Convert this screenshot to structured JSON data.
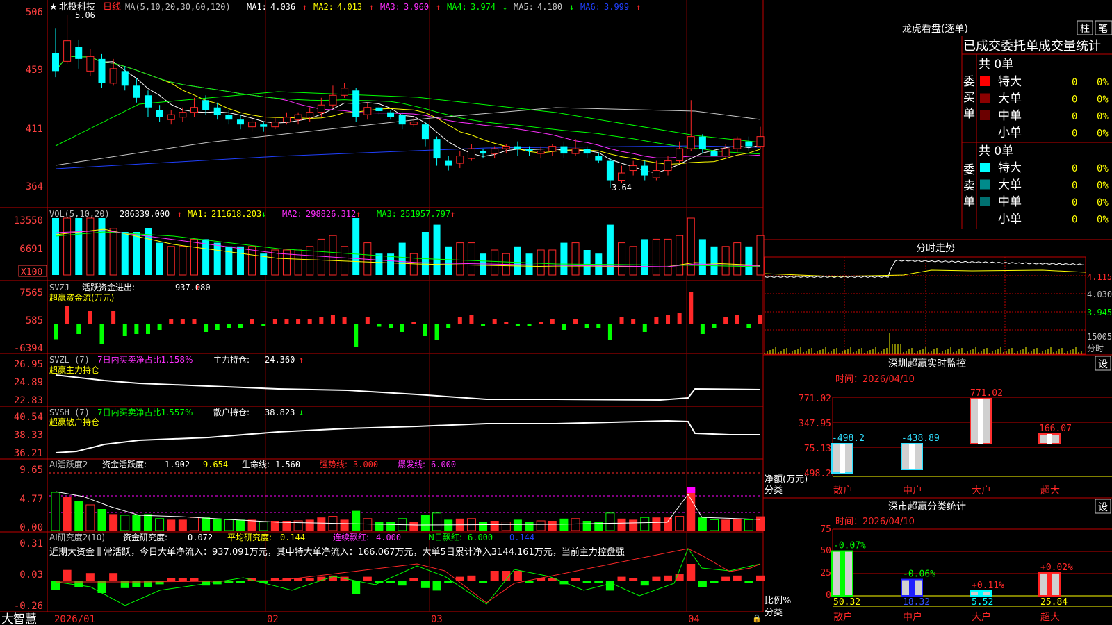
{
  "colors": {
    "up": "#ff2828",
    "down": "#00ffff",
    "frame": "#c00000",
    "grid": "#7a0000",
    "ma1": "#ffffff",
    "ma2": "#ffff00",
    "ma3": "#ff30ff",
    "ma4": "#00ff00",
    "ma5": "#c8c8c8",
    "ma6": "#2040ff",
    "green": "#00ff00",
    "magenta": "#ff00ff",
    "yellow": "#ffff00",
    "axis_text": "#ff4040"
  },
  "header": {
    "star": "★",
    "stock_name": "北投科技",
    "period": "日线",
    "ma_param": "MA(5,10,20,30,60,120)",
    "ma_values": [
      {
        "label": "MA1:",
        "value": "4.036",
        "arrow": "↑"
      },
      {
        "label": "MA2:",
        "value": "4.013",
        "arrow": "↑"
      },
      {
        "label": "MA3:",
        "value": "3.960",
        "arrow": "↑"
      },
      {
        "label": "MA4:",
        "value": "3.974",
        "arrow": "↓"
      },
      {
        "label": "MA5:",
        "value": "4.180",
        "arrow": "↓"
      },
      {
        "label": "MA6:",
        "value": "3.999",
        "arrow": "↑"
      }
    ]
  },
  "price_panel": {
    "y_ticks": [
      "506",
      "459",
      "411",
      "364"
    ],
    "high_label": "5.06",
    "low_label": "3.64"
  },
  "vol_panel": {
    "title": "VOL(5,10,20)",
    "value": "286339.000",
    "value_arrow": "↑",
    "ma_values": [
      {
        "label": "MA1:",
        "value": "211618.203",
        "arrow": "↓"
      },
      {
        "label": "MA2:",
        "value": "298826.312",
        "arrow": "↑"
      },
      {
        "label": "MA3:",
        "value": "251957.797",
        "arrow": "↑"
      }
    ],
    "y_ticks": [
      "13550",
      "6691"
    ],
    "unit": "X100"
  },
  "svzj_panel": {
    "title": "SVZJ",
    "desc": "活跃资金进出:",
    "value": "937.080",
    "arrow": "↑",
    "subtitle": "超赢资金流(万元)",
    "y_ticks": [
      "7565",
      "585",
      "-6394"
    ]
  },
  "svzl_panel": {
    "title": "SVZL (7)",
    "desc": "7日内买卖净占比1.158%",
    "hold_label": "主力持仓:",
    "hold_value": "24.360",
    "arrow": "↑",
    "subtitle": "超赢主力持仓",
    "y_ticks": [
      "26.95",
      "24.89",
      "22.83"
    ]
  },
  "svsh_panel": {
    "title": "SVSH (7)",
    "desc": "7日内买卖净占比1.557%",
    "hold_label": "散户持仓:",
    "hold_value": "38.823",
    "arrow": "↓",
    "subtitle": "超赢散户持仓",
    "y_ticks": [
      "40.54",
      "38.33",
      "36.21"
    ]
  },
  "ai_active_panel": {
    "title": "AI活跃度2",
    "label1": "资金活跃度:",
    "value1": "1.902",
    "value2": "9.654",
    "label3": "生命线:",
    "value3": "1.560",
    "label4": "强势线:",
    "value4": "3.000",
    "label5": "爆发线:",
    "value5": "6.000",
    "y_ticks": [
      "9.65",
      "4.77",
      "0.00"
    ]
  },
  "ai_research_panel": {
    "title": "AI研究度2(10)",
    "label1": "资金研究度:",
    "value1": "0.072",
    "label2": "平均研究度:",
    "value2": "0.144",
    "label3": "连续飘红:",
    "value3": "4.000",
    "label4": "N日飘红:",
    "value4": "6.000",
    "value5": "0.144",
    "comment": "近期大资金非常活跃，今日大单净流入：937.091万元，其中特大单净流入：166.067万元，大单5日累计净入3144.161万元，当前主力控盘强",
    "y_ticks": [
      "0.31",
      "0.03",
      "-0.26"
    ]
  },
  "footer": {
    "brand": "大智慧",
    "dates": [
      "2026/01",
      "02",
      "03",
      "04"
    ]
  },
  "right_panel": {
    "lhb_title": "龙虎看盘(逐单)",
    "btn_zhu": "柱",
    "btn_bi": "笔",
    "stat_title": "已成交委托单成交量统计",
    "buy_group": {
      "side_label": "委买单",
      "total": "共 0单",
      "rows": [
        {
          "name": "特大",
          "count": "0",
          "pct": "0%",
          "color": "#ff0000"
        },
        {
          "name": "大单",
          "count": "0",
          "pct": "0%",
          "color": "#8b0000"
        },
        {
          "name": "中单",
          "count": "0",
          "pct": "0%",
          "color": "#6b0000"
        },
        {
          "name": "小单",
          "count": "0",
          "pct": "0%",
          "color": ""
        }
      ]
    },
    "sell_group": {
      "side_label": "委卖单",
      "total": "共 0单",
      "rows": [
        {
          "name": "特大",
          "count": "0",
          "pct": "0%",
          "color": "#00ffff"
        },
        {
          "name": "大单",
          "count": "0",
          "pct": "0%",
          "color": "#008b8b"
        },
        {
          "name": "中单",
          "count": "0",
          "pct": "0%",
          "color": "#007070"
        },
        {
          "name": "小单",
          "count": "0",
          "pct": "0%",
          "color": ""
        }
      ]
    },
    "intraday": {
      "title": "分时走势",
      "y_ticks": [
        "4.115",
        "4.030",
        "3.945"
      ],
      "vol_tick": "15005",
      "vol_unit": "分时"
    },
    "monitor": {
      "title": "深圳超赢实时监控",
      "settings": "设",
      "time_label": "时间：2026/04/10",
      "y_ticks": [
        "771.02",
        "347.95",
        "-75.13",
        "-498.2"
      ],
      "net_label": "净额(万元)",
      "cat_label": "分类",
      "categories": [
        "散户",
        "中户",
        "大户",
        "超大"
      ],
      "values": [
        -498.2,
        -438.89,
        771.02,
        166.07
      ],
      "value_labels": [
        "-498.2",
        "-438.89",
        "771.02",
        "166.07"
      ]
    },
    "classify": {
      "title": "深市超赢分类统计",
      "settings": "设",
      "time_label": "时间：2026/04/10",
      "y_ticks": [
        "75",
        "50",
        "25",
        "0"
      ],
      "ratio_label": "比例%",
      "cat_label": "分类",
      "categories": [
        "散户",
        "中户",
        "大户",
        "超大"
      ],
      "values": [
        50.32,
        18.32,
        5.52,
        25.84
      ],
      "value_labels": [
        "50.32",
        "18.32",
        "5.52",
        "25.84"
      ],
      "change_labels": [
        "-0.07%",
        "-0.06%",
        "+0.11%",
        "+0.02%"
      ],
      "bar_colors": [
        "#00ff00",
        "#2020ff",
        "#00ffff",
        "#ff2020"
      ]
    }
  },
  "chart_data": {
    "type": "candlestick",
    "dates": [
      "2026/01",
      "02",
      "03",
      "04"
    ],
    "candles": [
      [
        4.75,
        4.6,
        4.95,
        4.55
      ],
      [
        4.68,
        4.85,
        5.06,
        4.66
      ],
      [
        4.8,
        4.7,
        4.86,
        4.62
      ],
      [
        4.6,
        4.72,
        4.78,
        4.56
      ],
      [
        4.7,
        4.5,
        4.74,
        4.46
      ],
      [
        4.5,
        4.62,
        4.7,
        4.48
      ],
      [
        4.6,
        4.48,
        4.64,
        4.44
      ],
      [
        4.48,
        4.38,
        4.54,
        4.34
      ],
      [
        4.4,
        4.3,
        4.44,
        4.22
      ],
      [
        4.28,
        4.22,
        4.32,
        4.18
      ],
      [
        4.2,
        4.24,
        4.28,
        4.16
      ],
      [
        4.22,
        4.26,
        4.3,
        4.18
      ],
      [
        4.26,
        4.3,
        4.38,
        4.22
      ],
      [
        4.36,
        4.28,
        4.4,
        4.24
      ],
      [
        4.3,
        4.24,
        4.34,
        4.2
      ],
      [
        4.24,
        4.2,
        4.28,
        4.16
      ],
      [
        4.2,
        4.16,
        4.24,
        4.12
      ],
      [
        4.14,
        4.18,
        4.22,
        4.1
      ],
      [
        4.16,
        4.14,
        4.18,
        4.1
      ],
      [
        4.14,
        4.18,
        4.22,
        4.12
      ],
      [
        4.18,
        4.22,
        4.26,
        4.16
      ],
      [
        4.2,
        4.24,
        4.26,
        4.16
      ],
      [
        4.22,
        4.26,
        4.3,
        4.18
      ],
      [
        4.26,
        4.32,
        4.38,
        4.22
      ],
      [
        4.32,
        4.4,
        4.48,
        4.3
      ],
      [
        4.4,
        4.46,
        4.5,
        4.38
      ],
      [
        4.44,
        4.22,
        4.46,
        4.18
      ],
      [
        4.24,
        4.3,
        4.34,
        4.2
      ],
      [
        4.3,
        4.27,
        4.32,
        4.24
      ],
      [
        4.26,
        4.22,
        4.28,
        4.2
      ],
      [
        4.24,
        4.16,
        4.26,
        4.12
      ],
      [
        4.16,
        4.18,
        4.22,
        4.14
      ],
      [
        4.16,
        4.04,
        4.18,
        3.98
      ],
      [
        4.04,
        3.88,
        4.06,
        3.82
      ],
      [
        3.86,
        3.82,
        3.9,
        3.78
      ],
      [
        3.84,
        3.9,
        3.94,
        3.8
      ],
      [
        3.88,
        3.96,
        4.0,
        3.86
      ],
      [
        3.94,
        3.92,
        3.96,
        3.88
      ],
      [
        3.92,
        3.96,
        3.98,
        3.88
      ],
      [
        3.96,
        3.98,
        4.0,
        3.92
      ],
      [
        3.98,
        3.96,
        4.02,
        3.9
      ],
      [
        3.96,
        3.94,
        3.98,
        3.9
      ],
      [
        3.92,
        3.94,
        3.98,
        3.88
      ],
      [
        3.94,
        3.98,
        4.0,
        3.9
      ],
      [
        3.98,
        3.92,
        4.02,
        3.88
      ],
      [
        3.92,
        3.96,
        4.04,
        3.9
      ],
      [
        3.96,
        3.92,
        3.98,
        3.88
      ],
      [
        3.9,
        3.86,
        3.92,
        3.84
      ],
      [
        3.86,
        3.7,
        3.88,
        3.64
      ],
      [
        3.7,
        3.76,
        3.82,
        3.68
      ],
      [
        3.78,
        3.82,
        3.86,
        3.74
      ],
      [
        3.82,
        3.74,
        3.86,
        3.7
      ],
      [
        3.72,
        3.78,
        3.86,
        3.7
      ],
      [
        3.78,
        3.86,
        3.9,
        3.74
      ],
      [
        3.86,
        3.96,
        4.02,
        3.84
      ],
      [
        3.96,
        4.06,
        4.36,
        3.94
      ],
      [
        4.06,
        3.96,
        4.08,
        3.92
      ],
      [
        3.94,
        3.9,
        3.98,
        3.86
      ],
      [
        3.9,
        3.96,
        4.0,
        3.88
      ],
      [
        3.96,
        4.04,
        4.06,
        3.92
      ],
      [
        4.02,
        3.98,
        4.06,
        3.94
      ],
      [
        3.98,
        4.06,
        4.14,
        3.96
      ]
    ]
  }
}
